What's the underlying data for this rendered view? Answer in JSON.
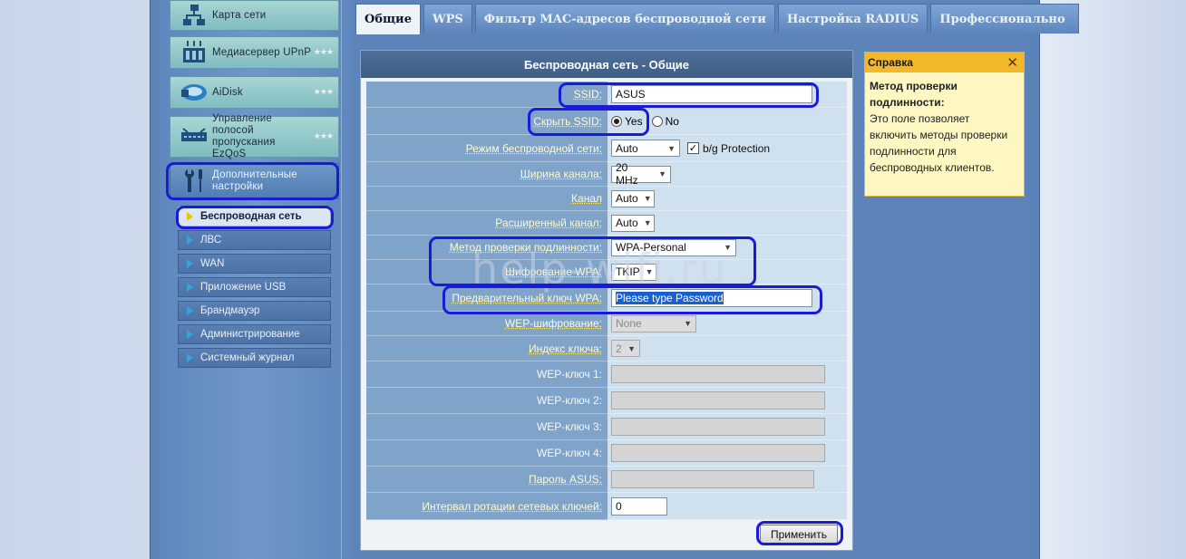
{
  "sidebar": {
    "items": [
      {
        "label": "Карта сети",
        "icon": "network-map-icon"
      },
      {
        "label": "Медиасервер UPnP",
        "icon": "media-server-icon"
      },
      {
        "label": "AiDisk",
        "icon": "aidisk-icon"
      },
      {
        "label": "Управление полосой пропускания EzQoS",
        "icon": "ezqos-icon"
      },
      {
        "label": "Дополнительные настройки",
        "icon": "tools-icon"
      }
    ],
    "submenu": [
      {
        "label": "Беспроводная сеть"
      },
      {
        "label": "ЛВС"
      },
      {
        "label": "WAN"
      },
      {
        "label": "Приложение USB"
      },
      {
        "label": "Брандмауэр"
      },
      {
        "label": "Администрирование"
      },
      {
        "label": "Системный журнал"
      }
    ]
  },
  "tabs": [
    "Общие",
    "WPS",
    "Фильтр MAC-адресов беспроводной сети",
    "Настройка RADIUS",
    "Профессионально"
  ],
  "panel": {
    "title": "Беспроводная сеть - Общие",
    "ssid_label": "SSID:",
    "ssid_value": "ASUS",
    "hide_ssid_label": "Скрыть SSID:",
    "yes": "Yes",
    "no": "No",
    "mode_label": "Режим беспроводной сети:",
    "mode_value": "Auto",
    "bg_protection": "b/g Protection",
    "width_label": "Ширина канала:",
    "width_value": "20 MHz",
    "channel_label": "Канал",
    "channel_value": "Auto",
    "ext_channel_label": "Расширенный канал:",
    "ext_channel_value": "Auto",
    "auth_label": "Метод проверки подлинности:",
    "auth_value": "WPA-Personal",
    "enc_label": "Шифрование WPA:",
    "enc_value": "TKIP",
    "psk_label": "Предварительный ключ WPA:",
    "psk_value": "Please type Password",
    "wep_label": "WEP-шифрование:",
    "wep_value": "None",
    "key_index_label": "Индекс ключа:",
    "key_index_value": "2",
    "wep1_label": "WEP-ключ 1:",
    "wep2_label": "WEP-ключ 2:",
    "wep3_label": "WEP-ключ 3:",
    "wep4_label": "WEP-ключ 4:",
    "asus_pass_label": "Пароль ASUS:",
    "rekey_label": "Интервал ротации сетевых ключей:",
    "rekey_value": "0",
    "apply": "Применить"
  },
  "help": {
    "title": "Справка",
    "heading": "Метод проверки подлинности:",
    "text": "Это поле позволяет включить методы проверки подлинности для беспроводных клиентов."
  },
  "watermark": "help-wifi.ru",
  "colors": {
    "highlight": "#1a1ad8",
    "help_header": "#f3b72c",
    "panel_header": "#4f6f98"
  }
}
